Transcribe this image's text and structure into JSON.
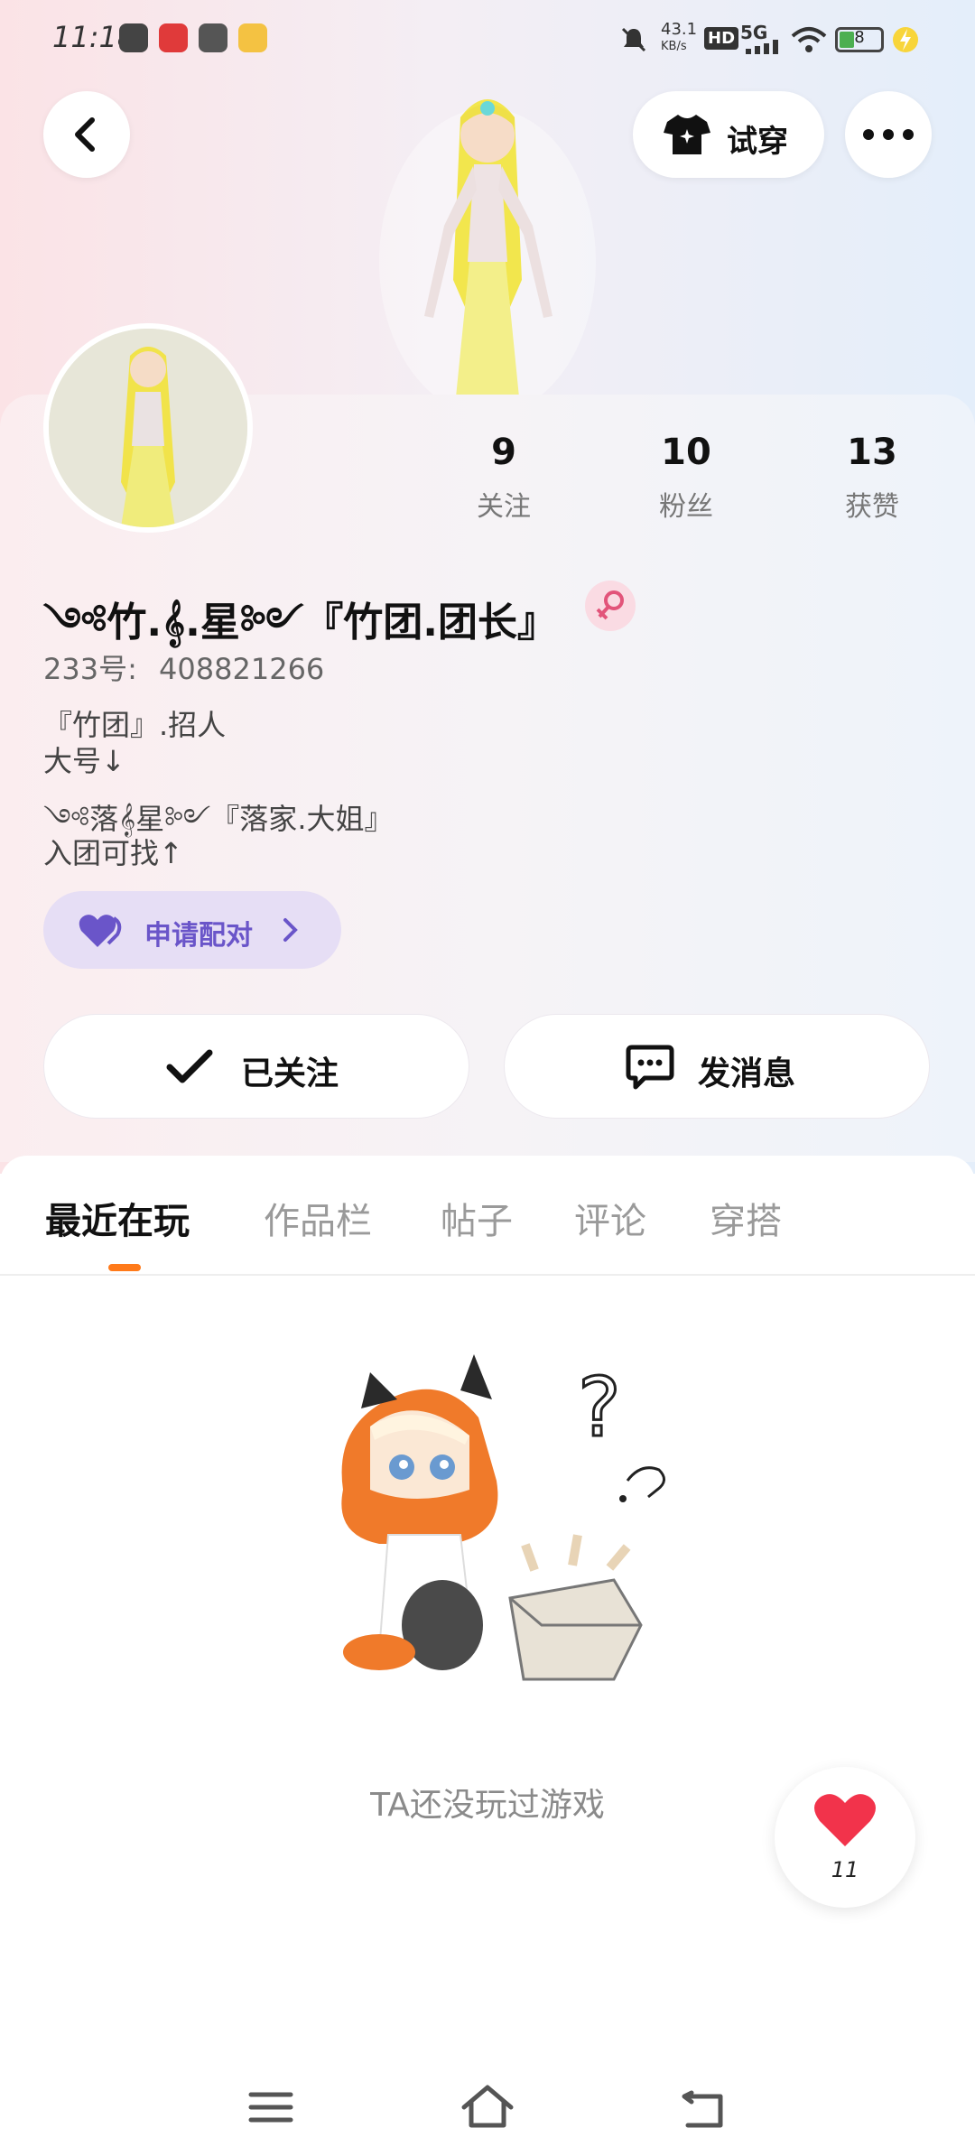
{
  "status_bar": {
    "time": "11:18",
    "net_speed": "43.1",
    "net_unit": "KB/s",
    "hd": "HD",
    "network": "5G",
    "battery": "8"
  },
  "header": {
    "try_on_label": "试穿"
  },
  "stats": [
    {
      "value": "9",
      "label": "关注"
    },
    {
      "value": "10",
      "label": "粉丝"
    },
    {
      "value": "13",
      "label": "获赞"
    }
  ],
  "profile": {
    "nickname": "༺竹.𝄞.星༻『竹团.团长』",
    "uid_label": "233号:",
    "uid_value": "408821266",
    "bio": [
      "『竹团』.招人",
      "大号↓",
      "༺落𝄞星༻『落家.大姐』",
      "入团可找↑"
    ]
  },
  "pair_button": {
    "label": "申请配对"
  },
  "actions": {
    "follow_label": "已关注",
    "message_label": "发消息"
  },
  "tabs": [
    {
      "label": "最近在玩",
      "active": true
    },
    {
      "label": "作品栏",
      "active": false
    },
    {
      "label": "帖子",
      "active": false
    },
    {
      "label": "评论",
      "active": false
    },
    {
      "label": "穿搭",
      "active": false
    }
  ],
  "empty_state": {
    "text": "TA还没玩过游戏"
  },
  "like_fab": {
    "count": "11"
  },
  "colors": {
    "accent_orange": "#ff7a1a",
    "pair_purple": "#6a55c9",
    "heart_red": "#f2334b"
  }
}
